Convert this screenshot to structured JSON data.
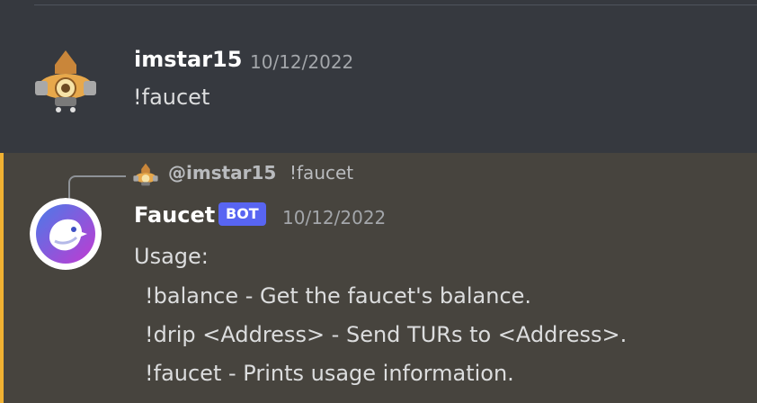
{
  "messages": [
    {
      "author": "imstar15",
      "timestamp": "10/12/2022",
      "content": "!faucet"
    },
    {
      "reply": {
        "mention": "@imstar15",
        "text": "!faucet"
      },
      "author": "Faucet",
      "badge": "BOT",
      "timestamp": "10/12/2022",
      "lines": [
        "Usage:",
        "!balance - Get the faucet's balance.",
        "!drip <Address> - Send TURs to <Address>.",
        "!faucet - Prints usage information."
      ]
    }
  ],
  "colors": {
    "background": "#36393f",
    "highlight_background": "#47443e",
    "highlight_border": "#f0b132",
    "bot_badge": "#5865f2"
  }
}
